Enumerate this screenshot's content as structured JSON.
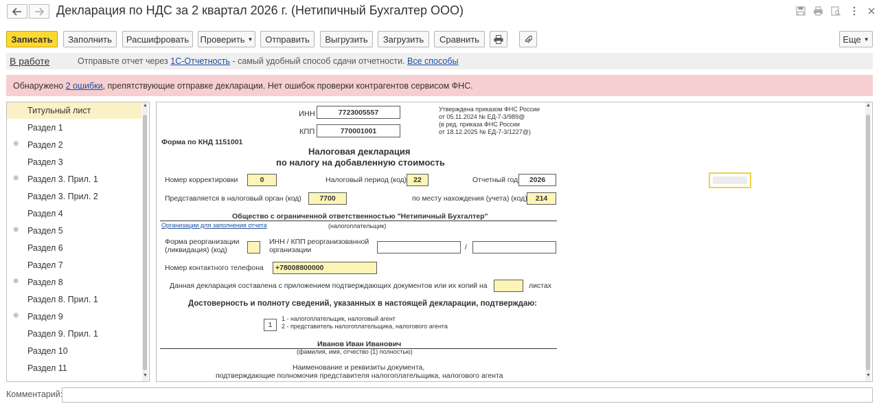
{
  "window": {
    "title": "Декларация по НДС за 2 квартал 2026 г. (Нетипичный Бухгалтер ООО)"
  },
  "toolbar": {
    "save": "Записать",
    "fill": "Заполнить",
    "decode": "Расшифровать",
    "check": "Проверить",
    "send": "Отправить",
    "export": "Выгрузить",
    "import": "Загрузить",
    "compare": "Сравнить",
    "more": "Еще"
  },
  "status": {
    "state": "В работе",
    "offer_before": "Отправьте отчет через",
    "offer_link": "1С-Отчетность",
    "offer_middle": "- самый удобный способ сдачи отчетности.",
    "offer_all": "Все способы"
  },
  "errors": {
    "before": "Обнаружено",
    "link": "2 ошибки",
    "after": ", препятствующие отправке декларации. Нет ошибок проверки контрагентов сервисом ФНС."
  },
  "sections": [
    {
      "label": "Титульный лист",
      "expandable": false,
      "selected": true
    },
    {
      "label": "Раздел 1",
      "expandable": false
    },
    {
      "label": "Раздел 2",
      "expandable": true
    },
    {
      "label": "Раздел 3",
      "expandable": false
    },
    {
      "label": "Раздел 3. Прил. 1",
      "expandable": true
    },
    {
      "label": "Раздел 3. Прил. 2",
      "expandable": false
    },
    {
      "label": "Раздел 4",
      "expandable": false
    },
    {
      "label": "Раздел 5",
      "expandable": true
    },
    {
      "label": "Раздел 6",
      "expandable": false
    },
    {
      "label": "Раздел 7",
      "expandable": false
    },
    {
      "label": "Раздел 8",
      "expandable": true
    },
    {
      "label": "Раздел 8. Прил. 1",
      "expandable": false
    },
    {
      "label": "Раздел 9",
      "expandable": true
    },
    {
      "label": "Раздел 9. Прил. 1",
      "expandable": false
    },
    {
      "label": "Раздел 10",
      "expandable": false
    },
    {
      "label": "Раздел 11",
      "expandable": false
    }
  ],
  "form": {
    "inn_label": "ИНН",
    "inn": "7723005557",
    "kpp_label": "КПП",
    "kpp": "770001001",
    "approved_1": "Утверждена приказом ФНС России",
    "approved_2": "от 05.11.2024 № ЕД-7-3/989@",
    "approved_3": "(в ред. приказа ФНС России",
    "approved_4": "от 18.12.2025 № ЕД-7-3/1227@)",
    "knd": "Форма по КНД 1151001",
    "heading_1": "Налоговая декларация",
    "heading_2": "по налогу на добавленную стоимость",
    "correction_label": "Номер корректировки",
    "correction": "0",
    "period_label": "Налоговый период (код)",
    "period": "22",
    "year_label": "Отчетный год",
    "year": "2026",
    "authority_label": "Представляется в налоговый орган (код)",
    "authority": "7700",
    "location_label": "по месту нахождения (учета) (код)",
    "location": "214",
    "org_name": "Общество с ограниченной ответственностью \"Нетипичный Бухгалтер\"",
    "org_link": "Организации для заполнения отчета",
    "taxpayer_caption": "(налогоплательщик)",
    "reorg_label_1": "Форма реорганизации",
    "reorg_label_2": "(ликвидация) (код)",
    "reorg_inn_label_1": "ИНН / КПП реорганизованной",
    "reorg_inn_label_2": "организации",
    "slash": "/",
    "phone_label": "Номер контактного телефона",
    "phone": "+78008800000",
    "docs_label": "Данная декларация составлена с приложением подтверждающих документов или их копий на",
    "sheets_label": "листах",
    "confirm_heading": "Достоверность и полноту сведений, указанных в настоящей декларации, подтверждаю:",
    "signer_code": "1",
    "signer_opt_1": "1 - налогоплательщик, налоговый агент",
    "signer_opt_2": "2 - представитель налогоплательщика, налогового агента",
    "signer_name": "Иванов Иван Иванович",
    "signer_caption": "(фамилия, имя, отчество (1)  полностью)",
    "doc_caption_1": "Наименование и реквизиты документа,",
    "doc_caption_2": "подтверждающие полномочия представителя налогоплательщика, налогового агента"
  },
  "comment": {
    "label": "Комментарий:",
    "value": ""
  },
  "colors": {
    "accent": "#fdd833",
    "error_bg": "#f7cfd0",
    "link": "#1a4fa3",
    "cell_fill": "#fdf5b5"
  }
}
